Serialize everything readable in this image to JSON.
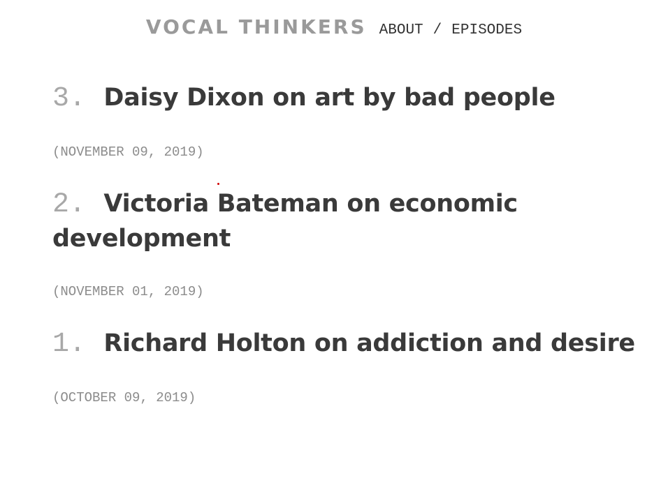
{
  "header": {
    "brand": "VOCAL THINKERS",
    "nav": {
      "about_label": "ABOUT",
      "separator": "/",
      "episodes_label": "EPISODES"
    }
  },
  "episodes": [
    {
      "number": "3.",
      "title": "Daisy Dixon on art by bad people",
      "date": "(NOVEMBER 09, 2019)"
    },
    {
      "number": "2.",
      "title": "Victoria Bateman on economic development",
      "date": "(NOVEMBER 01, 2019)"
    },
    {
      "number": "1.",
      "title": "Richard Holton on addiction and desire",
      "date": "(OCTOBER 09, 2019)"
    }
  ]
}
